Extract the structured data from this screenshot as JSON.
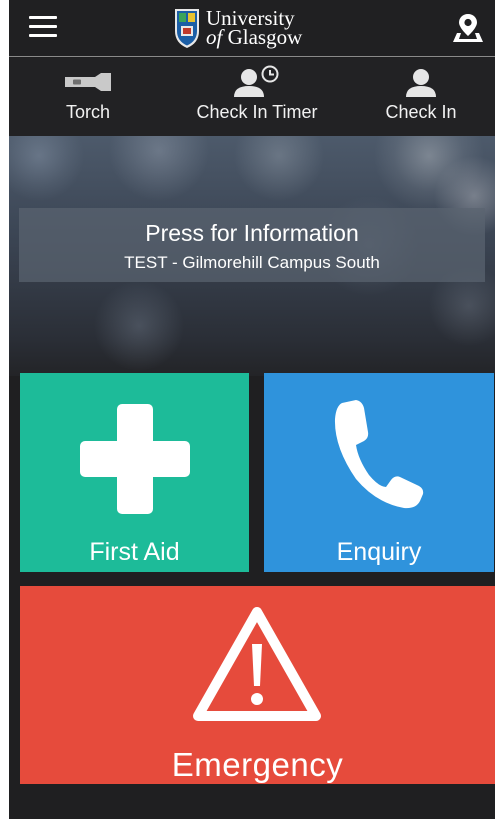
{
  "header": {
    "logo_line1": "University",
    "logo_line2_prefix": "of",
    "logo_line2_suffix": "Glasgow"
  },
  "toolbar": {
    "items": [
      {
        "label": "Torch",
        "icon": "torch-icon"
      },
      {
        "label": "Check In Timer",
        "icon": "user-clock-icon"
      },
      {
        "label": "Check In",
        "icon": "user-icon"
      }
    ]
  },
  "info": {
    "title": "Press for Information",
    "subtitle": "TEST - Gilmorehill Campus South"
  },
  "tiles": {
    "first_aid": {
      "label": "First Aid",
      "color": "#1dbb99",
      "icon": "cross-icon"
    },
    "enquiry": {
      "label": "Enquiry",
      "color": "#2f93dc",
      "icon": "phone-icon"
    },
    "emergency": {
      "label": "Emergency",
      "color": "#e64b3c",
      "icon": "warning-icon"
    }
  }
}
